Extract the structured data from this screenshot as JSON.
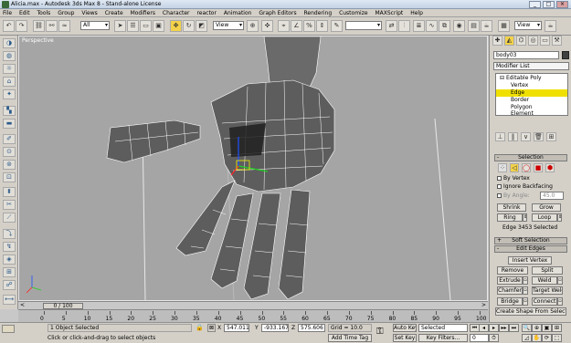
{
  "window": {
    "title": "Alicia.max - Autodesk 3ds Max 8 - Stand-alone License",
    "min": "_",
    "max": "□",
    "close": "×"
  },
  "menu": [
    "File",
    "Edit",
    "Tools",
    "Group",
    "Views",
    "Create",
    "Modifiers",
    "Character",
    "reactor",
    "Animation",
    "Graph Editors",
    "Rendering",
    "Customize",
    "MAXScript",
    "Help"
  ],
  "toolbar": {
    "selection_filter": "All",
    "ref_coord": "View",
    "named_sel": "",
    "view_dd": "View"
  },
  "viewport": {
    "label": "Perspective"
  },
  "right_panel": {
    "object_name": "body03",
    "modifier_list": "Modifier List",
    "stack": [
      "Editable Poly",
      "Vertex",
      "Edge",
      "Border",
      "Polygon",
      "Element"
    ],
    "stack_selected": "Edge",
    "selection": {
      "title": "Selection",
      "by_vertex": "By Vertex",
      "ignore_backfacing": "Ignore Backfacing",
      "by_angle": "By Angle:",
      "angle_value": "45.0",
      "shrink": "Shrink",
      "grow": "Grow",
      "ring": "Ring",
      "loop": "Loop",
      "status": "Edge 3453 Selected"
    },
    "soft_selection": "Soft Selection",
    "edit_edges": {
      "title": "Edit Edges",
      "insert_vertex": "Insert Vertex",
      "remove": "Remove",
      "split": "Split",
      "extrude": "Extrude",
      "weld": "Weld",
      "chamfer": "Chamfer",
      "target_weld": "Target Weld",
      "bridge": "Bridge",
      "connect": "Connect",
      "create_shape": "Create Shape From Selection"
    }
  },
  "timeline": {
    "slider": "0 / 100",
    "ticks": [
      "0",
      "5",
      "10",
      "15",
      "20",
      "25",
      "30",
      "35",
      "40",
      "45",
      "50",
      "55",
      "60",
      "65",
      "70",
      "75",
      "80",
      "85",
      "90",
      "95",
      "100"
    ]
  },
  "status": {
    "selection": "1 Object Selected",
    "prompt": "Click or click-and-drag to select objects",
    "x_label": "X",
    "x": "547.011",
    "y_label": "Y",
    "y": "-933.167",
    "z_label": "Z",
    "z": "575.606",
    "grid": "Grid = 10.0",
    "add_time_tag": "Add Time Tag",
    "auto_key": "Auto Key",
    "set_key": "Set Key",
    "key_mode": "Selected",
    "key_filters": "Key Filters...",
    "frame": "0"
  }
}
